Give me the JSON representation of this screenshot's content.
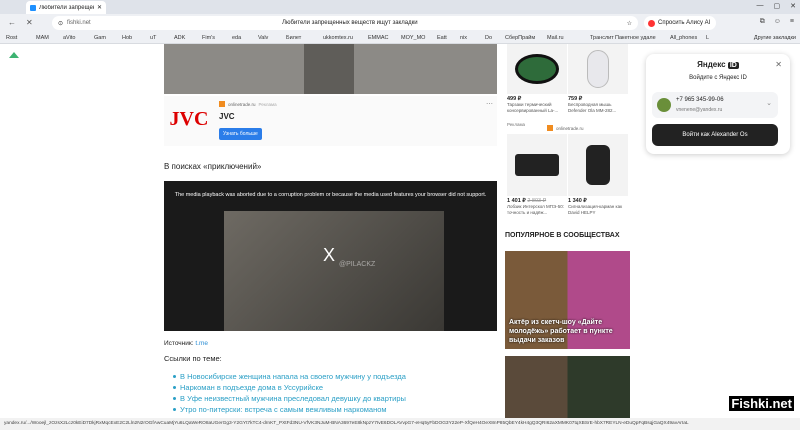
{
  "tab": {
    "title": "Любители запрещенн..."
  },
  "window": {
    "minimize": "—",
    "maximize": "▢",
    "close": "✕"
  },
  "address": {
    "host": "fishki.net",
    "page_title": "Любители запрещенных веществ ищут закладки"
  },
  "alice": {
    "label": "Спросить Алису AI"
  },
  "bookmarks": [
    "Rost",
    "MAM",
    "aVito",
    "Gam",
    "Hob",
    "uT",
    "ADK",
    "Fim's",
    "eda",
    "Valv",
    "Билет",
    "ukkomtex.ru",
    "EMMAC",
    "MOY_MO",
    "Eatt",
    "nix",
    "Do",
    "СберПрайм",
    "Mail.ru",
    "Транслит",
    "Пакетное удале",
    "All_phones",
    "L"
  ],
  "bookmarks_other": "Другие закладки",
  "ad": {
    "source": "onlinetrade.ru",
    "source_tag": "Реклама",
    "brand": "JVC",
    "logo": "JVC",
    "button": "Узнать больше"
  },
  "article": {
    "heading": "В поисках «приключений»",
    "video_error": "The media playback was aborted due to a corruption problem or because the media used features your browser did not support.",
    "video_close": "X",
    "watermark": "@PILACKZ",
    "source_label": "Источник:",
    "source_link": "t.me",
    "related_heading": "Ссылки по теме:",
    "related": [
      "В Новосибирске женщина напала на своего мужчину у подъезда",
      "Наркоман в подъезде дома в Уссурийске",
      "В Уфе неизвестный мужчина преследовал девушку до квартиры",
      "Утро по-питерски: встреча с самым вежливым наркоманом"
    ]
  },
  "products": [
    {
      "price": "499 ₽",
      "desc": "Тарзаки термический консервированный La-..."
    },
    {
      "price": "759 ₽",
      "desc": "Беспроводная мышь Defender Ola MM-282..."
    },
    {
      "price": "1 401 ₽",
      "old": "2 803 ₽",
      "desc": "Лобзик Интерскол МПЭ-50: точность и надёж..."
    },
    {
      "price": "1 340 ₽",
      "desc": "Сигнализация-карман как David HELPY"
    }
  ],
  "ads_label": "Реклама",
  "ad2_source": "onlinetrade.ru",
  "popular": {
    "heading": "ПОПУЛЯРНОЕ В СООБЩЕСТВАХ",
    "tile1": "Актёр из скетч-шоу «Дайте молодёжь» работает в пункте выдачи заказов"
  },
  "yandex_id": {
    "title": "Яндекс",
    "badge": "ID",
    "close": "✕",
    "subtitle": "Войдите с Яндекс ID",
    "phone": "+7 965 345-99-06",
    "email": "vnenene@yandex.ru",
    "login_button": "Войти как Alexander Os"
  },
  "statusbar": "yandex.ru/.../Wooejl_zOzsX2Lcz0kEiD7DkjRxMqcExE2C2Lln2N2rOGfAwCuaMjYu6LQaWeRO8aUGerGg3-Y2GYt7kTC4-drnKT_PXtFd3NU-VfVK3NJuM-BNA3697eE8kNpzY7IvE6DOLAVvpG7-eHq5yFbDOG3Y22eP-XfQeH4OeX8nP85QbEY4kH4gQ3QRI62aXMMK07tqXBSrE-hbX7REYLN-eDuQpFqBsqjGaQX49avArIaL",
  "watermark_site": "Fishki.net"
}
